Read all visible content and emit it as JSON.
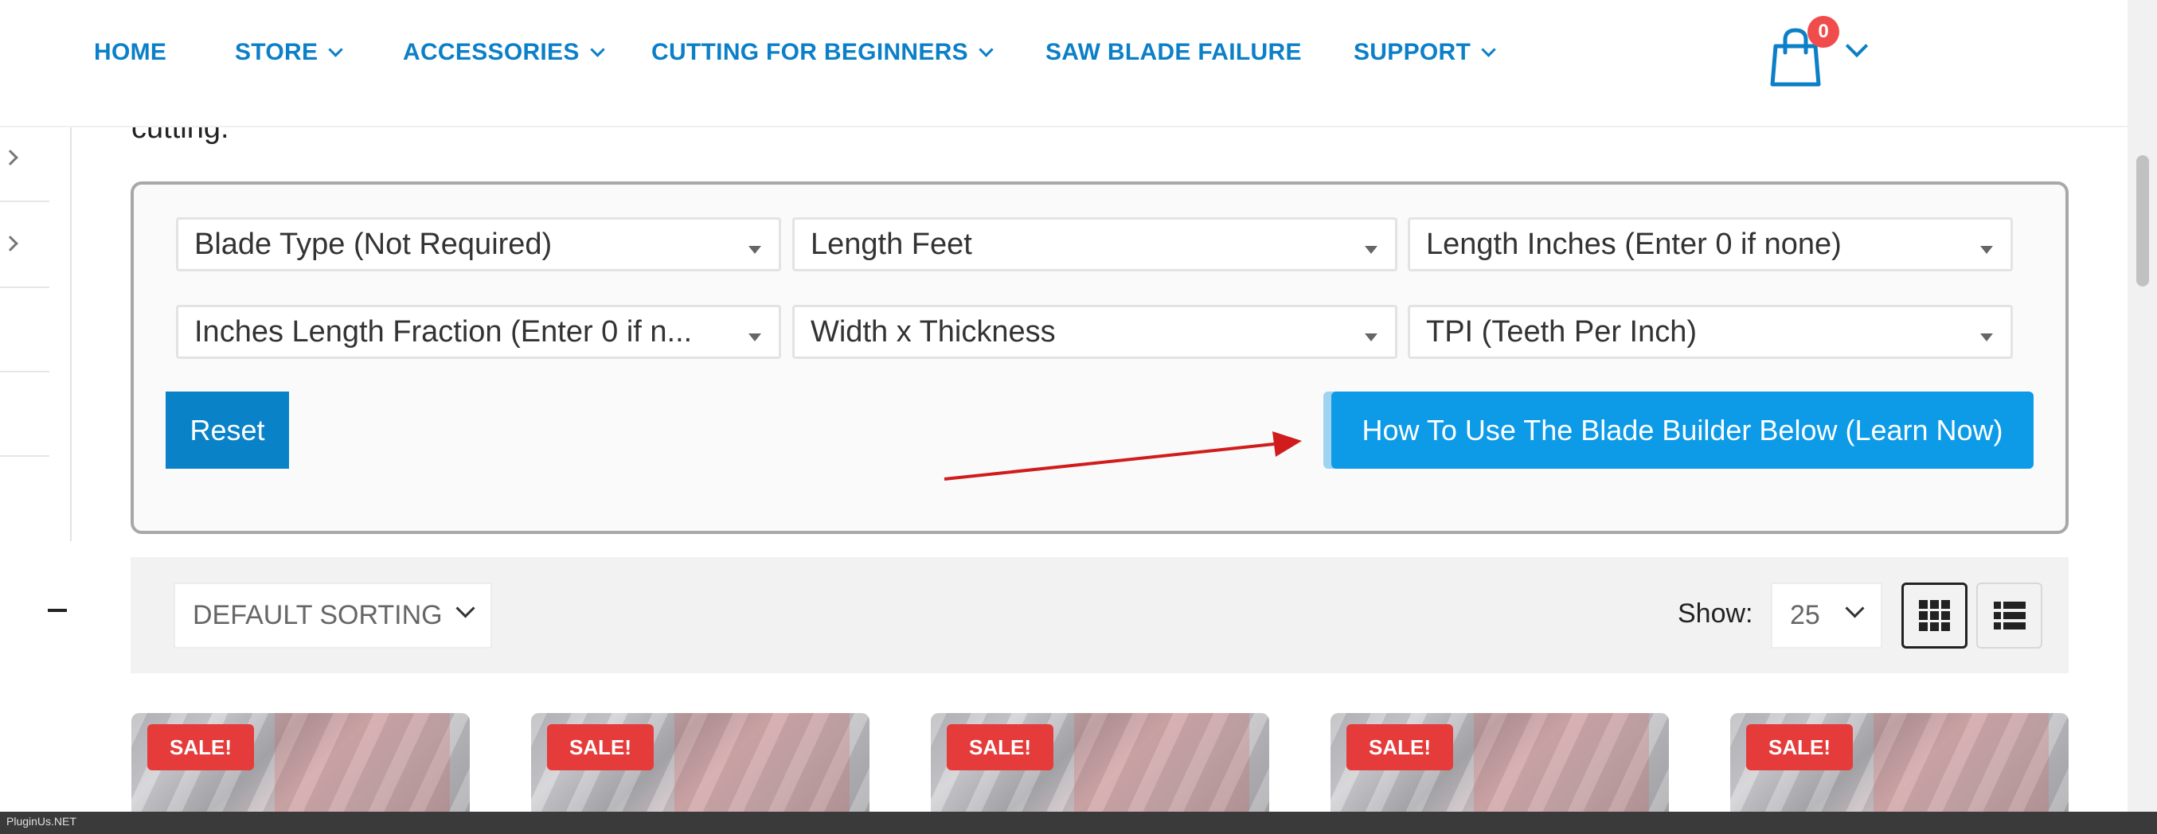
{
  "header": {
    "nav": [
      {
        "label": "HOME",
        "dropdown": false
      },
      {
        "label": "STORE",
        "dropdown": true
      },
      {
        "label": "ACCESSORIES",
        "dropdown": true
      },
      {
        "label": "CUTTING FOR BEGINNERS",
        "dropdown": true
      },
      {
        "label": "SAW BLADE FAILURE",
        "dropdown": false
      },
      {
        "label": "SUPPORT",
        "dropdown": true
      }
    ],
    "cart_count": "0",
    "cart_icon": "shopping-bag-icon"
  },
  "partial_text": "cutting.",
  "filters": {
    "blade_type": "Blade Type (Not Required)",
    "length_feet": "Length Feet",
    "length_inches": "Length Inches (Enter 0 if none)",
    "inches_fraction": "Inches Length Fraction (Enter 0 if n...",
    "width_thickness": "Width x Thickness",
    "tpi": "TPI (Teeth Per Inch)",
    "reset_label": "Reset",
    "learn_label": "How To Use The Blade Builder Below (Learn Now)"
  },
  "sorting": {
    "selected": "DEFAULT SORTING",
    "show_label": "Show:",
    "show_value": "25"
  },
  "products": [
    {
      "badge": "SALE!"
    },
    {
      "badge": "SALE!"
    },
    {
      "badge": "SALE!"
    },
    {
      "badge": "SALE!"
    },
    {
      "badge": "SALE!"
    }
  ],
  "status_bar": {
    "text": "PluginUs.NET"
  },
  "colors": {
    "nav": "#0b7fc7",
    "reset_button": "#0a82c8",
    "learn_button": "#0d9be8",
    "sale_badge": "#e63b3b",
    "cart_badge": "#f04c4c",
    "arrow": "#d01c1c"
  }
}
